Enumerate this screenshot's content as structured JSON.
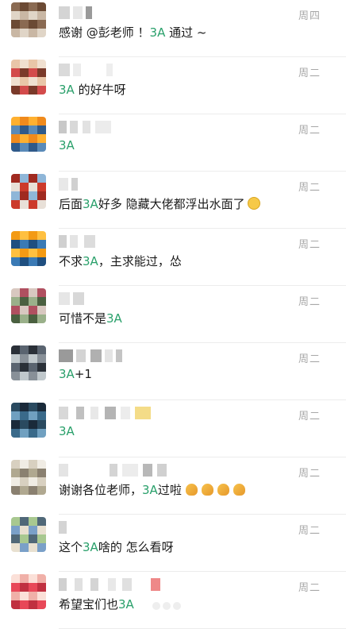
{
  "colors": {
    "highlight": "#2aa06b",
    "time": "#a8a8a8",
    "text": "#1a1a1a",
    "divider": "#ececec"
  },
  "chats": [
    {
      "time": "周四",
      "segments": [
        {
          "t": "感谢 @彭老师 ！"
        },
        {
          "t": "3A",
          "hl": true
        },
        {
          "t": " 通过 ~"
        }
      ]
    },
    {
      "time": "周二",
      "segments": [
        {
          "t": "3A",
          "hl": true
        },
        {
          "t": " 的好牛呀"
        }
      ]
    },
    {
      "time": "周二",
      "segments": [
        {
          "t": "3A",
          "hl": true
        }
      ]
    },
    {
      "time": "周二",
      "segments": [
        {
          "t": "后面"
        },
        {
          "t": "3A",
          "hl": true
        },
        {
          "t": "好多 隐藏大佬都浮出水面了"
        }
      ],
      "emoji": [
        "thinking-face-emoji"
      ]
    },
    {
      "time": "周二",
      "segments": [
        {
          "t": "不求"
        },
        {
          "t": "3A",
          "hl": true
        },
        {
          "t": "，主求能过，怂"
        }
      ]
    },
    {
      "time": "周二",
      "segments": [
        {
          "t": "可惜不是"
        },
        {
          "t": "3A",
          "hl": true
        }
      ]
    },
    {
      "time": "周二",
      "segments": [
        {
          "t": "3A",
          "hl": true
        },
        {
          "t": "+1"
        }
      ]
    },
    {
      "time": "周二",
      "segments": [
        {
          "t": "3A",
          "hl": true
        }
      ]
    },
    {
      "time": "周二",
      "segments": [
        {
          "t": "谢谢各位老师，"
        },
        {
          "t": "3A",
          "hl": true
        },
        {
          "t": "过啦"
        }
      ],
      "emoji": [
        "clap-emoji",
        "clap-emoji",
        "clap-emoji",
        "clap-emoji"
      ]
    },
    {
      "time": "周二",
      "segments": [
        {
          "t": "这个"
        },
        {
          "t": "3A",
          "hl": true
        },
        {
          "t": "啥的 怎么看呀"
        }
      ]
    },
    {
      "time": "周二",
      "segments": [
        {
          "t": "希望宝们也"
        },
        {
          "t": "3A",
          "hl": true
        }
      ]
    }
  ]
}
